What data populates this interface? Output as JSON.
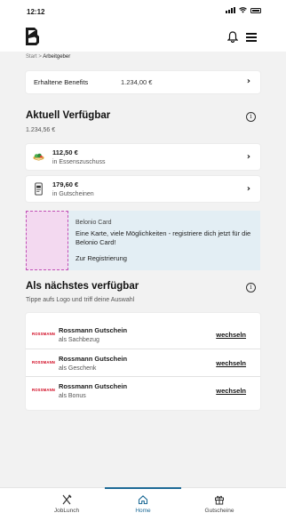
{
  "status_bar": {
    "time": "12:12"
  },
  "breadcrumb": {
    "home": "Start",
    "separator": ">",
    "current": "Arbeitgeber"
  },
  "benefits": {
    "label": "Erhaltene Benefits",
    "value": "1.234,00 €"
  },
  "available": {
    "title": "Aktuell Verfügbar",
    "total": "1.234,56 €",
    "items": [
      {
        "amount": "112,50 €",
        "description": "in Essenszuschuss",
        "icon": "salad-bowl-icon"
      },
      {
        "amount": "179,60 €",
        "description": "in Gutscheinen",
        "icon": "phone-voucher-icon"
      }
    ]
  },
  "promo": {
    "title": "Belonio Card",
    "text": "Eine Karte, viele Möglichkeiten - registriere dich jetzt für die Belonio Card!",
    "link": "Zur Registrierung"
  },
  "next_available": {
    "title": "Als nächstes verfügbar",
    "subtitle": "Tippe aufs Logo und triff deine Auswahl",
    "items": [
      {
        "logo": "ROSSMANN",
        "name": "Rossmann Gutschein",
        "type": "als Sachbezug",
        "action": "wechseln"
      },
      {
        "logo": "ROSSMANN",
        "name": "Rossmann Gutschein",
        "type": "als Geschenk",
        "action": "wechseln"
      },
      {
        "logo": "ROSSMANN",
        "name": "Rossmann Gutschein",
        "type": "als Bonus",
        "action": "wechseln"
      }
    ]
  },
  "tabs": [
    {
      "label": "JobLunch",
      "icon": "cutlery-icon",
      "active": false
    },
    {
      "label": "Home",
      "icon": "home-icon",
      "active": true
    },
    {
      "label": "Gutscheine",
      "icon": "gift-icon",
      "active": false
    }
  ],
  "colors": {
    "accent": "#1d6a96",
    "promo_bg": "#e3eef4",
    "rossmann_red": "#d0021b"
  }
}
